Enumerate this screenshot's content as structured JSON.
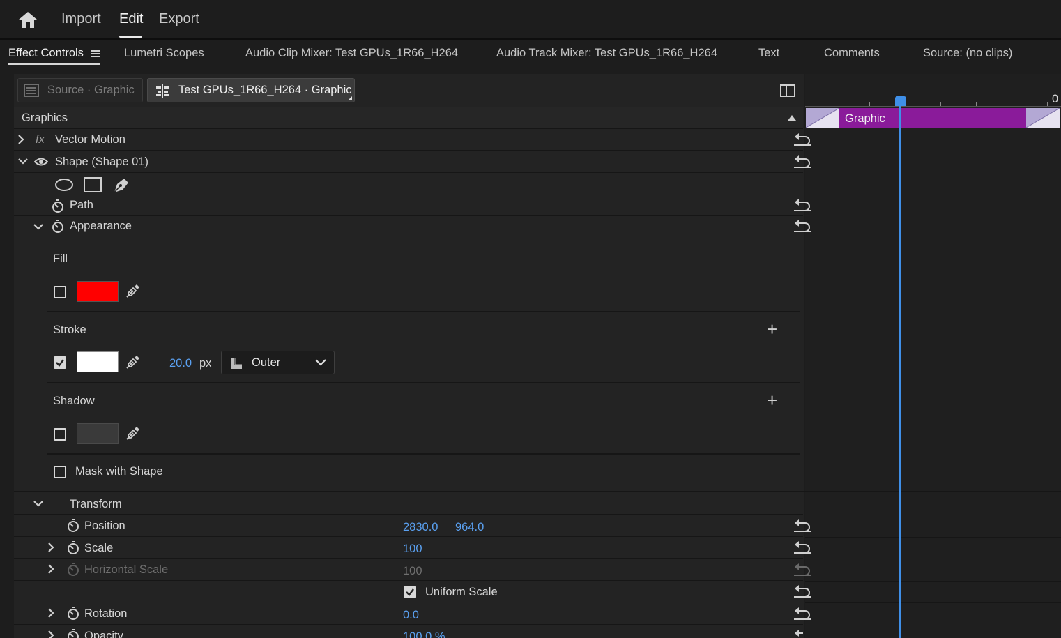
{
  "topbar": {
    "home_icon": "home-icon",
    "nav": [
      "Import",
      "Edit",
      "Export"
    ],
    "active": "Edit"
  },
  "tabs": [
    {
      "label": "Effect Controls"
    },
    {
      "label": "Lumetri Scopes"
    },
    {
      "label": "Audio Clip Mixer: Test GPUs_1R66_H264"
    },
    {
      "label": "Audio Track Mixer: Test GPUs_1R66_H264"
    },
    {
      "label": "Text"
    },
    {
      "label": "Comments"
    },
    {
      "label": "Source: (no clips)"
    }
  ],
  "source_buttons": {
    "source": "Source · Graphic",
    "sequence": "Test GPUs_1R66_H264 · Graphic"
  },
  "effects": {
    "section_title": "Graphics",
    "vector_motion": "Vector Motion",
    "fx_symbol": "fx",
    "shape_layer": "Shape (Shape 01)",
    "path": "Path",
    "appearance": "Appearance",
    "fill": {
      "label": "Fill",
      "enabled": false,
      "color": "#ff0000"
    },
    "stroke": {
      "label": "Stroke",
      "enabled": true,
      "color": "#ffffff",
      "width": "20.0",
      "unit": "px",
      "position": "Outer"
    },
    "shadow": {
      "label": "Shadow",
      "enabled": false,
      "color": "#3a3a3a"
    },
    "mask_with_shape": {
      "label": "Mask with Shape",
      "enabled": false
    },
    "transform": {
      "label": "Transform",
      "position": {
        "label": "Position",
        "x": "2830.0",
        "y": "964.0"
      },
      "scale": {
        "label": "Scale",
        "value": "100"
      },
      "horizontal_scale": {
        "label": "Horizontal Scale",
        "value": "100"
      },
      "uniform_scale": {
        "label": "Uniform Scale",
        "enabled": true
      },
      "rotation": {
        "label": "Rotation",
        "value": "0.0"
      },
      "opacity": {
        "label": "Opacity",
        "value": "100.0 %"
      }
    }
  },
  "timeline": {
    "clip_label": "Graphic",
    "ruler_label": "0",
    "clip_color": "#8a1b9a",
    "playhead_color": "#3f8fe8"
  }
}
